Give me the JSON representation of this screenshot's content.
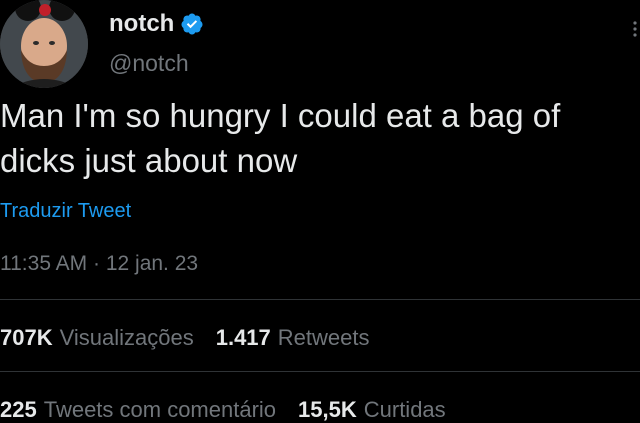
{
  "user": {
    "display_name": "notch",
    "handle": "@notch",
    "verified": true
  },
  "tweet": {
    "text": "Man I'm so hungry I could eat a bag of\ndicks just about now",
    "translate_label": "Traduzir Tweet",
    "timestamp": "11:35 AM · 12 jan. 23"
  },
  "stats": {
    "views_value": "707K",
    "views_label": "Visualizações",
    "retweets_value": "1.417",
    "retweets_label": "Retweets",
    "quotes_value": "225",
    "quotes_label": "Tweets com comentário",
    "likes_value": "15,5K",
    "likes_label": "Curtidas"
  },
  "colors": {
    "background": "#000000",
    "text_primary": "#e7e9ea",
    "text_secondary": "#71767b",
    "link": "#1d9bf0",
    "divider": "#2f3336",
    "verified_badge": "#1d9bf0"
  },
  "icons": {
    "verified": "verified-badge-icon",
    "more": "more-options-icon"
  }
}
